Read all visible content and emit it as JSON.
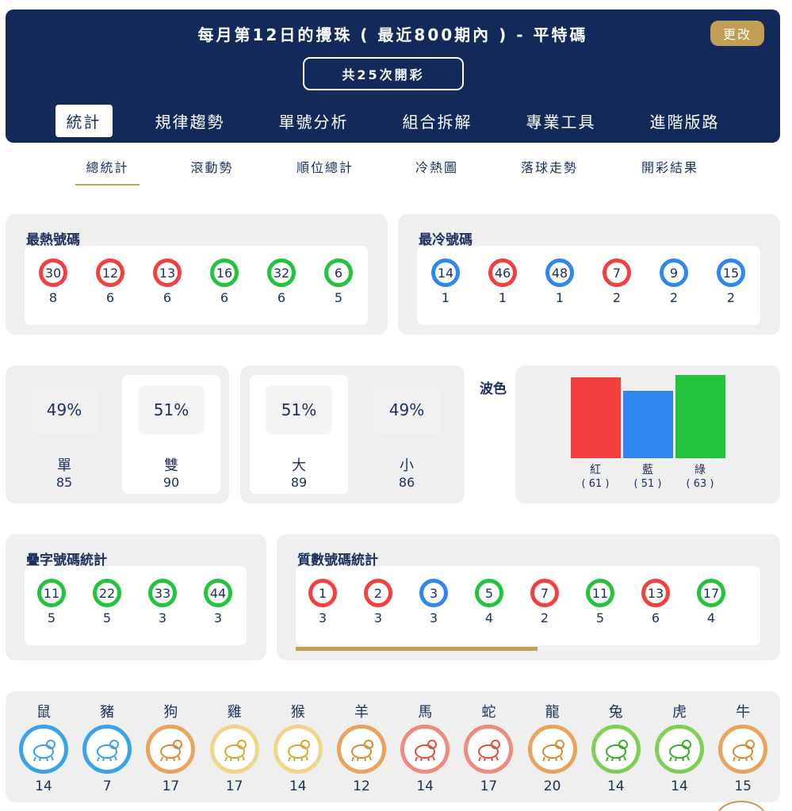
{
  "header": {
    "title": "每月第12日的攪珠 ( 最近800期內 ) - 平特碼",
    "change_label": "更改",
    "draw_count": "共25次開彩",
    "tabs": [
      {
        "label": "統計",
        "active": true
      },
      {
        "label": "規律趨勢"
      },
      {
        "label": "單號分析"
      },
      {
        "label": "組合拆解"
      },
      {
        "label": "專業工具"
      },
      {
        "label": "進階版路"
      }
    ]
  },
  "sub_tabs": [
    {
      "label": "總統計",
      "active": true
    },
    {
      "label": "滾動勢"
    },
    {
      "label": "順位總計"
    },
    {
      "label": "冷熱圖"
    },
    {
      "label": "落球走勢"
    },
    {
      "label": "開彩結果"
    }
  ],
  "hottest": {
    "title": "最熱號碼",
    "balls": [
      {
        "num": "30",
        "color": "red",
        "count": "8"
      },
      {
        "num": "12",
        "color": "red",
        "count": "6"
      },
      {
        "num": "13",
        "color": "red",
        "count": "6"
      },
      {
        "num": "16",
        "color": "green",
        "count": "6"
      },
      {
        "num": "32",
        "color": "green",
        "count": "6"
      },
      {
        "num": "6",
        "color": "green",
        "count": "5"
      }
    ]
  },
  "coldest": {
    "title": "最冷號碼",
    "balls": [
      {
        "num": "14",
        "color": "blue",
        "count": "1"
      },
      {
        "num": "46",
        "color": "red",
        "count": "1"
      },
      {
        "num": "48",
        "color": "blue",
        "count": "1"
      },
      {
        "num": "7",
        "color": "red",
        "count": "2"
      },
      {
        "num": "9",
        "color": "blue",
        "count": "2"
      },
      {
        "num": "15",
        "color": "blue",
        "count": "2"
      }
    ]
  },
  "odd_even": [
    {
      "pct": "49%",
      "label": "單",
      "value": "85"
    },
    {
      "pct": "51%",
      "label": "雙",
      "value": "90"
    }
  ],
  "big_small": [
    {
      "pct": "51%",
      "label": "大",
      "value": "89"
    },
    {
      "pct": "49%",
      "label": "小",
      "value": "86"
    }
  ],
  "wave_color": {
    "title": "波色",
    "bars": [
      {
        "label": "紅",
        "count_text": "( 61 )",
        "value": 61,
        "color": "#f43f3f"
      },
      {
        "label": "藍",
        "count_text": "( 51 )",
        "value": 51,
        "color": "#2e86f0"
      },
      {
        "label": "綠",
        "count_text": "( 63 )",
        "value": 63,
        "color": "#22c43c"
      }
    ]
  },
  "repeated": {
    "title": "疊字號碼統計",
    "balls": [
      {
        "num": "11",
        "color": "green",
        "count": "5"
      },
      {
        "num": "22",
        "color": "green",
        "count": "5"
      },
      {
        "num": "33",
        "color": "green",
        "count": "3"
      },
      {
        "num": "44",
        "color": "green",
        "count": "3"
      }
    ]
  },
  "prime": {
    "title": "質數號碼統計",
    "balls": [
      {
        "num": "1",
        "color": "red",
        "count": "3"
      },
      {
        "num": "2",
        "color": "red",
        "count": "3"
      },
      {
        "num": "3",
        "color": "blue",
        "count": "3"
      },
      {
        "num": "5",
        "color": "green",
        "count": "4"
      },
      {
        "num": "7",
        "color": "red",
        "count": "2"
      },
      {
        "num": "11",
        "color": "green",
        "count": "5"
      },
      {
        "num": "13",
        "color": "red",
        "count": "6"
      },
      {
        "num": "17",
        "color": "green",
        "count": "4"
      }
    ],
    "scroll_progress": 0.52
  },
  "zodiac": [
    {
      "name": "鼠",
      "count": "14",
      "icon": "rat-icon",
      "ring": "#3aa2ea",
      "fill": "#3aa2ea"
    },
    {
      "name": "豬",
      "count": "7",
      "icon": "pig-icon",
      "ring": "#3aa2ea",
      "fill": "#3aa2ea"
    },
    {
      "name": "狗",
      "count": "17",
      "icon": "dog-icon",
      "ring": "#e9a35c",
      "fill": "#d98a34"
    },
    {
      "name": "雞",
      "count": "17",
      "icon": "rooster-icon",
      "ring": "#f0d487",
      "fill": "#d6a92e"
    },
    {
      "name": "猴",
      "count": "14",
      "icon": "monkey-icon",
      "ring": "#f0d487",
      "fill": "#d6a92e"
    },
    {
      "name": "羊",
      "count": "12",
      "icon": "goat-icon",
      "ring": "#e9a35c",
      "fill": "#d98a34"
    },
    {
      "name": "馬",
      "count": "14",
      "icon": "horse-icon",
      "ring": "#f08a7a",
      "fill": "#e64b3c"
    },
    {
      "name": "蛇",
      "count": "17",
      "icon": "snake-icon",
      "ring": "#f08a7a",
      "fill": "#e64b3c"
    },
    {
      "name": "龍",
      "count": "20",
      "icon": "dragon-icon",
      "ring": "#e9a35c",
      "fill": "#d98a34"
    },
    {
      "name": "兔",
      "count": "14",
      "icon": "rabbit-icon",
      "ring": "#7ecf55",
      "fill": "#3cac2a"
    },
    {
      "name": "虎",
      "count": "14",
      "icon": "tiger-icon",
      "ring": "#7ecf55",
      "fill": "#3cac2a"
    },
    {
      "name": "牛",
      "count": "15",
      "icon": "ox-icon",
      "ring": "#e9a35c",
      "fill": "#d98a34"
    }
  ]
}
